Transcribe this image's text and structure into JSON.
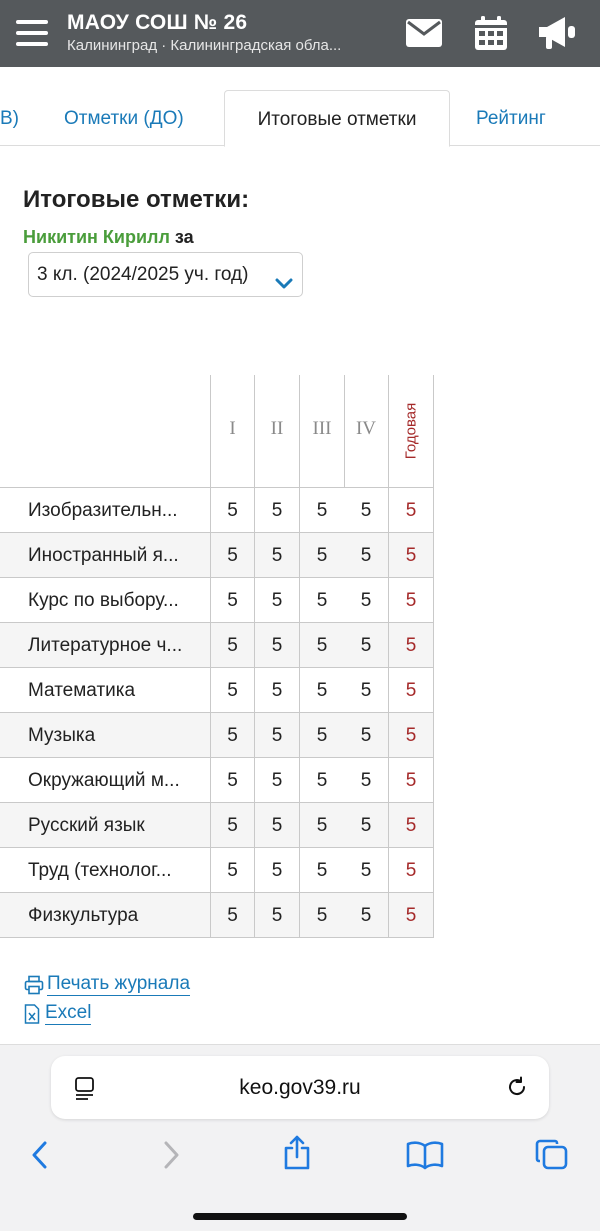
{
  "header": {
    "school_name": "МАОУ СОШ № 26",
    "school_region": "Калининград · Калининградская обла...",
    "icons": [
      "menu-icon",
      "envelope-icon",
      "calendar-icon",
      "megaphone-icon"
    ]
  },
  "tabs": [
    {
      "label": "В)",
      "active": false
    },
    {
      "label": "Отметки (ДО)",
      "active": false
    },
    {
      "label": "Итоговые отметки",
      "active": true
    },
    {
      "label": "Рейтинг",
      "active": false
    }
  ],
  "page_title": "Итоговые отметки:",
  "student": {
    "name": "Никитин Кирилл",
    "suffix": "за"
  },
  "year_select": {
    "value": "3 кл. (2024/2025 уч. год)"
  },
  "grades": {
    "columns": [
      "I",
      "II",
      "III",
      "IV",
      "Годовая"
    ],
    "rows": [
      {
        "subject": "Изобразительн...",
        "marks": [
          "5",
          "5",
          "5",
          "5",
          "5"
        ]
      },
      {
        "subject": "Иностранный я...",
        "marks": [
          "5",
          "5",
          "5",
          "5",
          "5"
        ]
      },
      {
        "subject": "Курс по выбору...",
        "marks": [
          "5",
          "5",
          "5",
          "5",
          "5"
        ]
      },
      {
        "subject": "Литературное ч...",
        "marks": [
          "5",
          "5",
          "5",
          "5",
          "5"
        ]
      },
      {
        "subject": "Математика",
        "marks": [
          "5",
          "5",
          "5",
          "5",
          "5"
        ]
      },
      {
        "subject": "Музыка",
        "marks": [
          "5",
          "5",
          "5",
          "5",
          "5"
        ]
      },
      {
        "subject": "Окружающий м...",
        "marks": [
          "5",
          "5",
          "5",
          "5",
          "5"
        ]
      },
      {
        "subject": "Русский язык",
        "marks": [
          "5",
          "5",
          "5",
          "5",
          "5"
        ]
      },
      {
        "subject": "Труд (технолог...",
        "marks": [
          "5",
          "5",
          "5",
          "5",
          "5"
        ]
      },
      {
        "subject": "Физкультура",
        "marks": [
          "5",
          "5",
          "5",
          "5",
          "5"
        ]
      }
    ]
  },
  "links": {
    "print": "Печать журнала",
    "excel": "Excel"
  },
  "browser": {
    "url": "keo.gov39.ru"
  },
  "colors": {
    "header_bg": "#55595c",
    "link": "#1a7ab8",
    "student_name": "#4a9d3b",
    "annual_mark": "#a52a2a",
    "quarter_header": "#8a8a8a",
    "grid_line": "#c9c9c9"
  }
}
